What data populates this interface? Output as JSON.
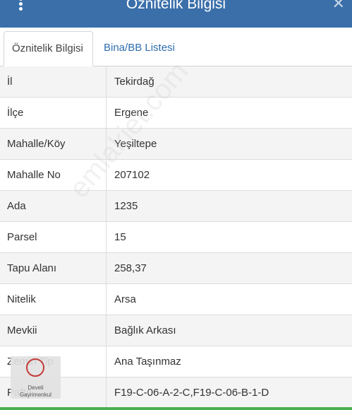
{
  "header": {
    "title": "Öznitelik Bilgisi",
    "close_label": "✕"
  },
  "tabs": [
    {
      "label": "Öznitelik Bilgisi",
      "active": true
    },
    {
      "label": "Bina/BB Listesi",
      "active": false
    }
  ],
  "rows": [
    {
      "label": "İl",
      "value": "Tekirdağ"
    },
    {
      "label": "İlçe",
      "value": "Ergene"
    },
    {
      "label": "Mahalle/Köy",
      "value": "Yeşiltepe"
    },
    {
      "label": "Mahalle No",
      "value": "207102"
    },
    {
      "label": "Ada",
      "value": "1235"
    },
    {
      "label": "Parsel",
      "value": "15"
    },
    {
      "label": "Tapu Alanı",
      "value": "258,37"
    },
    {
      "label": "Nitelik",
      "value": "Arsa"
    },
    {
      "label": "Mevkii",
      "value": "Bağlık Arkası"
    },
    {
      "label": "Zemin Tip",
      "value": "Ana Taşınmaz"
    },
    {
      "label": "Pafta",
      "value": "F19-C-06-A-2-C,F19-C-06-B-1-D"
    }
  ],
  "watermark": "emlakjet.com",
  "logo": {
    "line1": "Develi",
    "line2": "Gayrimenkul"
  },
  "colors": {
    "header_bg": "#3a6fa9",
    "tab_link": "#2f6fb0",
    "bottom_bar": "#4caf50"
  }
}
